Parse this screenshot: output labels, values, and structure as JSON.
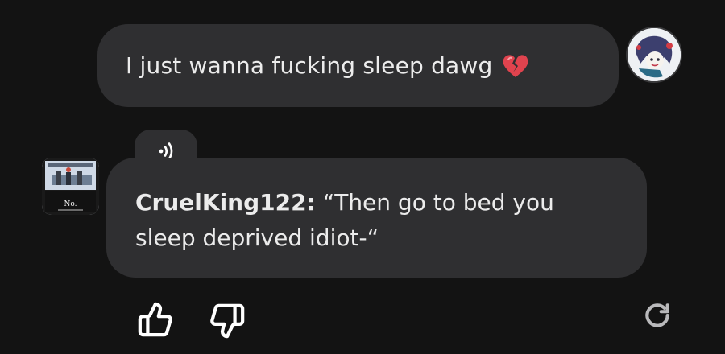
{
  "conversation": {
    "user_message": {
      "text": "I just wanna fucking sleep dawg",
      "emoji": "broken-heart-icon"
    },
    "bot_message": {
      "speaker": "CruelKing122:",
      "text": "“Then go to bed you sleep deprived idiot-“"
    },
    "avatar_caption": "No."
  },
  "actions": {
    "thumbs_up": "thumbs-up-icon",
    "thumbs_down": "thumbs-down-icon",
    "regenerate": "refresh-icon",
    "play_audio": "audio-play-icon"
  },
  "colors": {
    "background": "#131313",
    "bubble": "#2f2f31",
    "text": "#ececec",
    "heart": "#e0434e"
  }
}
